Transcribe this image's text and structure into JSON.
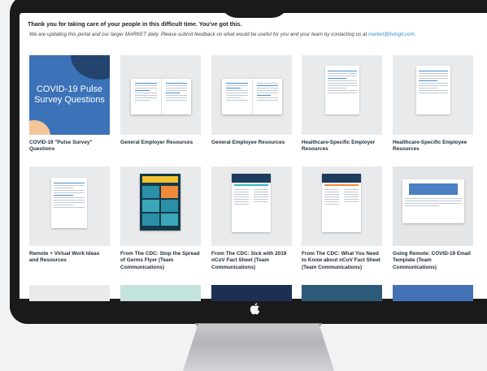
{
  "header": {
    "intro": "Thank you for taking care of your people in this difficult time. You've got this.",
    "sub_text": "We are updating this portal and our larger MARKET daily. Please submit feedback on what would be useful for you and your team by contacting us at",
    "email": "market@livingit.com",
    "sub_end": "."
  },
  "cover": {
    "title_line1": "COVID-19 Pulse",
    "title_line2": "Survey Questions"
  },
  "resources": [
    {
      "label": "COVID-19 \"Pulse Survey\" Questions"
    },
    {
      "label": "General Employer Resources"
    },
    {
      "label": "General Employee Resources"
    },
    {
      "label": "Healthcare-Specific Employer Resources"
    },
    {
      "label": "Healthcare-Specific Employee Resources"
    },
    {
      "label": "Remote + Virtual Work Ideas and Resources"
    },
    {
      "label": "From The CDC: Stop the Spread of Germs Flyer (Team Communications)"
    },
    {
      "label": "From The CDC: Sick with 2019 nCoV Fact Sheet (Team Communications)"
    },
    {
      "label": "From The CDC: What You Need to Know about nCoV Fact Sheet (Team Communications)"
    },
    {
      "label": "Going Remote: COVID-19 Email Template (Team Communications)"
    }
  ],
  "colors": {
    "accent_blue": "#3b72b8",
    "link": "#2f8fd6",
    "bezel": "#1a1a1b",
    "bottom_row": [
      "#e9eaeb",
      "#c4e3de",
      "#1d2f52",
      "#2d5a78",
      "#4372b6"
    ]
  },
  "icons": {
    "brand": "apple-logo-icon"
  }
}
